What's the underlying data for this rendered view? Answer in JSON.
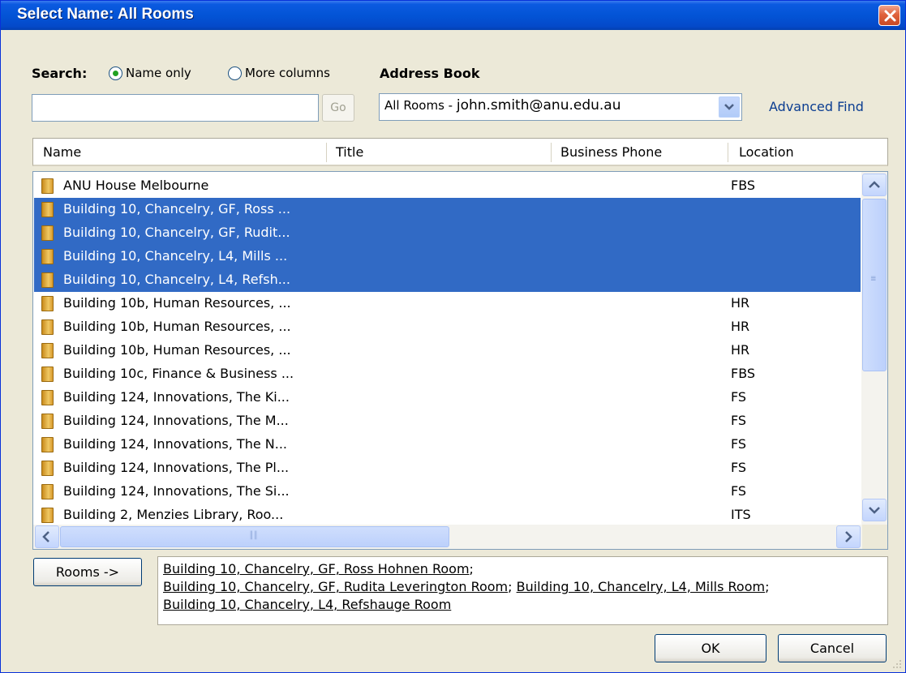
{
  "window": {
    "title": "Select Name: All Rooms"
  },
  "search": {
    "label": "Search:",
    "option_name_only": "Name only",
    "option_more_columns": "More columns",
    "selected_option": "Name only",
    "query": "",
    "go_label": "Go"
  },
  "address_book": {
    "label": "Address Book",
    "selected": "All Rooms - john.smith@anu.edu.au",
    "selected_prefix": "All Rooms - ",
    "selected_account": "john.smith@anu.edu.au",
    "advanced_find": "Advanced Find"
  },
  "columns": {
    "name": "Name",
    "title": "Title",
    "phone": "Business Phone",
    "location": "Location"
  },
  "rows": [
    {
      "name": "ANU House Melbourne",
      "location": "FBS",
      "selected": false
    },
    {
      "name": "Building 10, Chancelry, GF, Ross ...",
      "location": "",
      "selected": true
    },
    {
      "name": "Building 10, Chancelry, GF, Rudit...",
      "location": "",
      "selected": true
    },
    {
      "name": "Building 10, Chancelry, L4, Mills ...",
      "location": "",
      "selected": true
    },
    {
      "name": "Building 10, Chancelry, L4, Refsh...",
      "location": "",
      "selected": true
    },
    {
      "name": "Building 10b, Human Resources, ...",
      "location": "HR",
      "selected": false
    },
    {
      "name": "Building 10b, Human Resources, ...",
      "location": "HR",
      "selected": false
    },
    {
      "name": "Building 10b, Human Resources, ...",
      "location": "HR",
      "selected": false
    },
    {
      "name": "Building 10c, Finance & Business ...",
      "location": "FBS",
      "selected": false
    },
    {
      "name": "Building 124, Innovations, The Ki...",
      "location": "FS",
      "selected": false
    },
    {
      "name": "Building 124, Innovations, The M...",
      "location": "FS",
      "selected": false
    },
    {
      "name": "Building 124, Innovations, The N...",
      "location": "FS",
      "selected": false
    },
    {
      "name": "Building 124, Innovations, The Pl...",
      "location": "FS",
      "selected": false
    },
    {
      "name": "Building 124, Innovations, The Si...",
      "location": "FS",
      "selected": false
    },
    {
      "name": "Building 2, Menzies Library, Roo...",
      "location": "ITS",
      "selected": false
    }
  ],
  "rooms_button": "Rooms ->",
  "selected_rooms": [
    "Building 10, Chancelry, GF, Ross Hohnen Room",
    "Building 10, Chancelry, GF, Rudita Leverington Room",
    "Building 10, Chancelry, L4, Mills Room",
    "Building 10, Chancelry, L4, Refshauge Room"
  ],
  "buttons": {
    "ok": "OK",
    "cancel": "Cancel"
  },
  "colors": {
    "selection": "#316ac5",
    "titlebar": "#0354d6",
    "link": "#0b3d91"
  },
  "icons": {
    "close": "close-icon",
    "room": "room-icon",
    "dropdown": "chevron-down-icon"
  }
}
